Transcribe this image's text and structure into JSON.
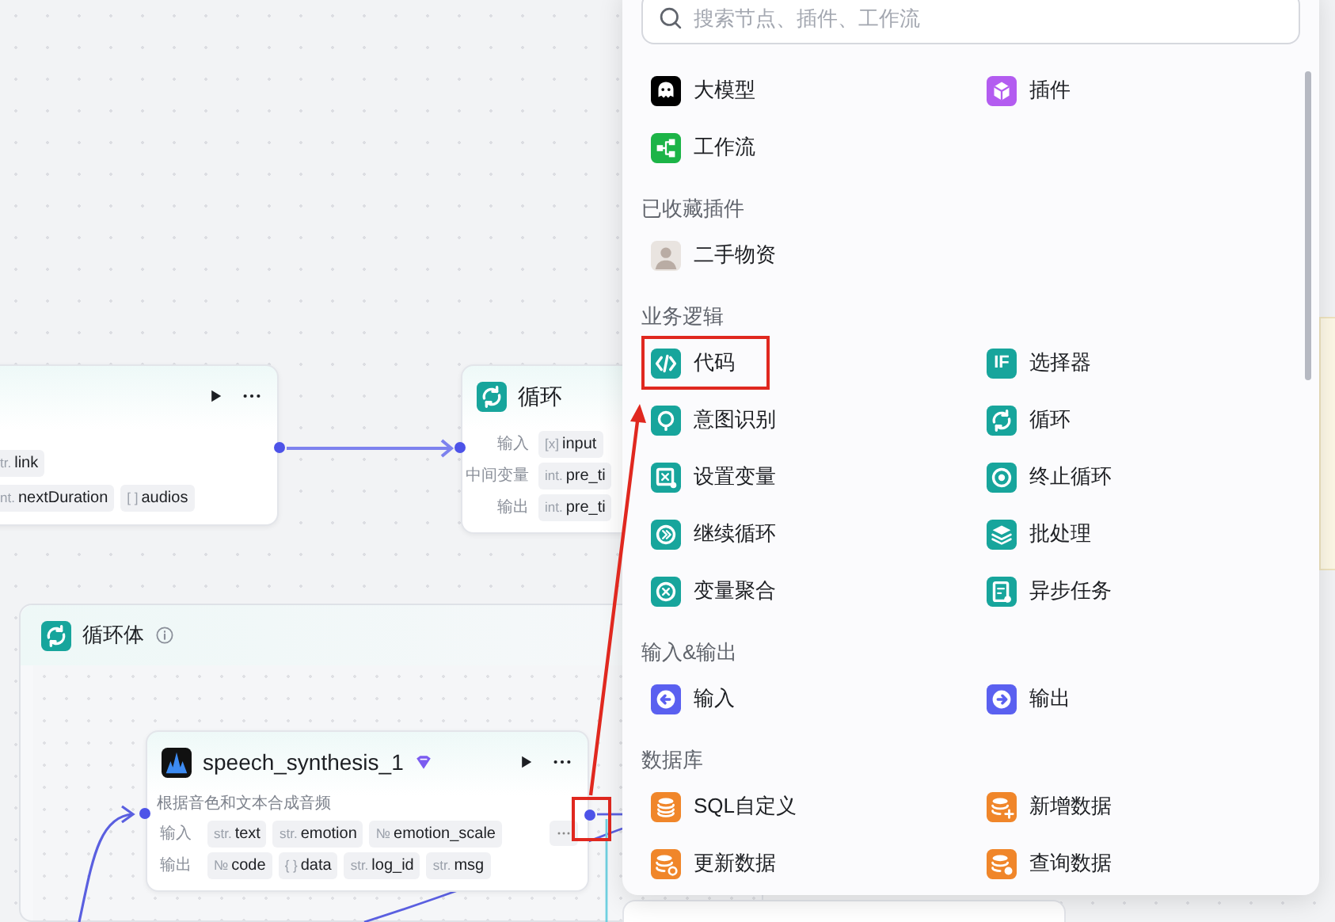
{
  "canvas": {
    "nodes": [
      {
        "kind": "node",
        "toolbar": true,
        "rows": [
          {
            "tags": [
              {
                "type": "tr.",
                "name": "link"
              }
            ]
          },
          {
            "tags": [
              {
                "type": "nt.",
                "name": "nextDuration"
              },
              {
                "type": "[ ]",
                "name": "audios"
              }
            ]
          }
        ]
      },
      {
        "kind": "node",
        "title": "循环",
        "rows": [
          {
            "label": "输入",
            "tags": [
              {
                "type": "[x]",
                "name": "input"
              }
            ]
          },
          {
            "label": "中间变量",
            "tags": [
              {
                "type": "int.",
                "name": "pre_ti"
              }
            ]
          },
          {
            "label": "输出",
            "tags": [
              {
                "type": "int.",
                "name": "pre_ti"
              }
            ]
          }
        ]
      },
      {
        "kind": "group",
        "title": "循环体",
        "info": true
      },
      {
        "kind": "node",
        "title": "speech_synthesis_1",
        "badge": true,
        "toolbar": true,
        "description": "根据音色和文本合成音频",
        "output_port_highlighted": true,
        "rows": [
          {
            "label": "输入",
            "more": true,
            "tags": [
              {
                "type": "str.",
                "name": "text"
              },
              {
                "type": "str.",
                "name": "emotion"
              },
              {
                "type": "№",
                "name": "emotion_scale"
              }
            ]
          },
          {
            "label": "输出",
            "tags": [
              {
                "type": "№",
                "name": "code"
              },
              {
                "type": "{ }",
                "name": "data"
              },
              {
                "type": "str.",
                "name": "log_id"
              },
              {
                "type": "str.",
                "name": "msg"
              }
            ]
          }
        ]
      }
    ]
  },
  "menu": {
    "search": {
      "placeholder": "搜索节点、插件、工作流"
    },
    "sections": [
      {
        "items": [
          {
            "label": "大模型",
            "highlighted": false
          },
          {
            "label": "插件",
            "highlighted": false
          },
          {
            "label": "工作流",
            "highlighted": false
          }
        ]
      },
      {
        "title": "已收藏插件",
        "items": [
          {
            "label": "二手物资",
            "highlighted": false
          }
        ]
      },
      {
        "title": "业务逻辑",
        "items": [
          {
            "label": "代码",
            "highlighted": true
          },
          {
            "label": "选择器",
            "icon_text": "IF",
            "highlighted": false
          },
          {
            "label": "意图识别",
            "highlighted": false
          },
          {
            "label": "循环",
            "highlighted": false
          },
          {
            "label": "设置变量",
            "highlighted": false
          },
          {
            "label": "终止循环",
            "highlighted": false
          },
          {
            "label": "继续循环",
            "highlighted": false
          },
          {
            "label": "批处理",
            "highlighted": false
          },
          {
            "label": "变量聚合",
            "highlighted": false
          },
          {
            "label": "异步任务",
            "highlighted": false
          }
        ]
      },
      {
        "title": "输入&输出",
        "items": [
          {
            "label": "输入",
            "highlighted": false
          },
          {
            "label": "输出",
            "highlighted": false
          }
        ]
      },
      {
        "title": "数据库",
        "items": [
          {
            "label": "SQL自定义",
            "highlighted": false
          },
          {
            "label": "新增数据",
            "highlighted": false
          },
          {
            "label": "更新数据",
            "highlighted": false
          },
          {
            "label": "查询数据",
            "highlighted": false
          }
        ]
      }
    ]
  },
  "annotations": [
    {
      "kind": "arrow"
    }
  ]
}
